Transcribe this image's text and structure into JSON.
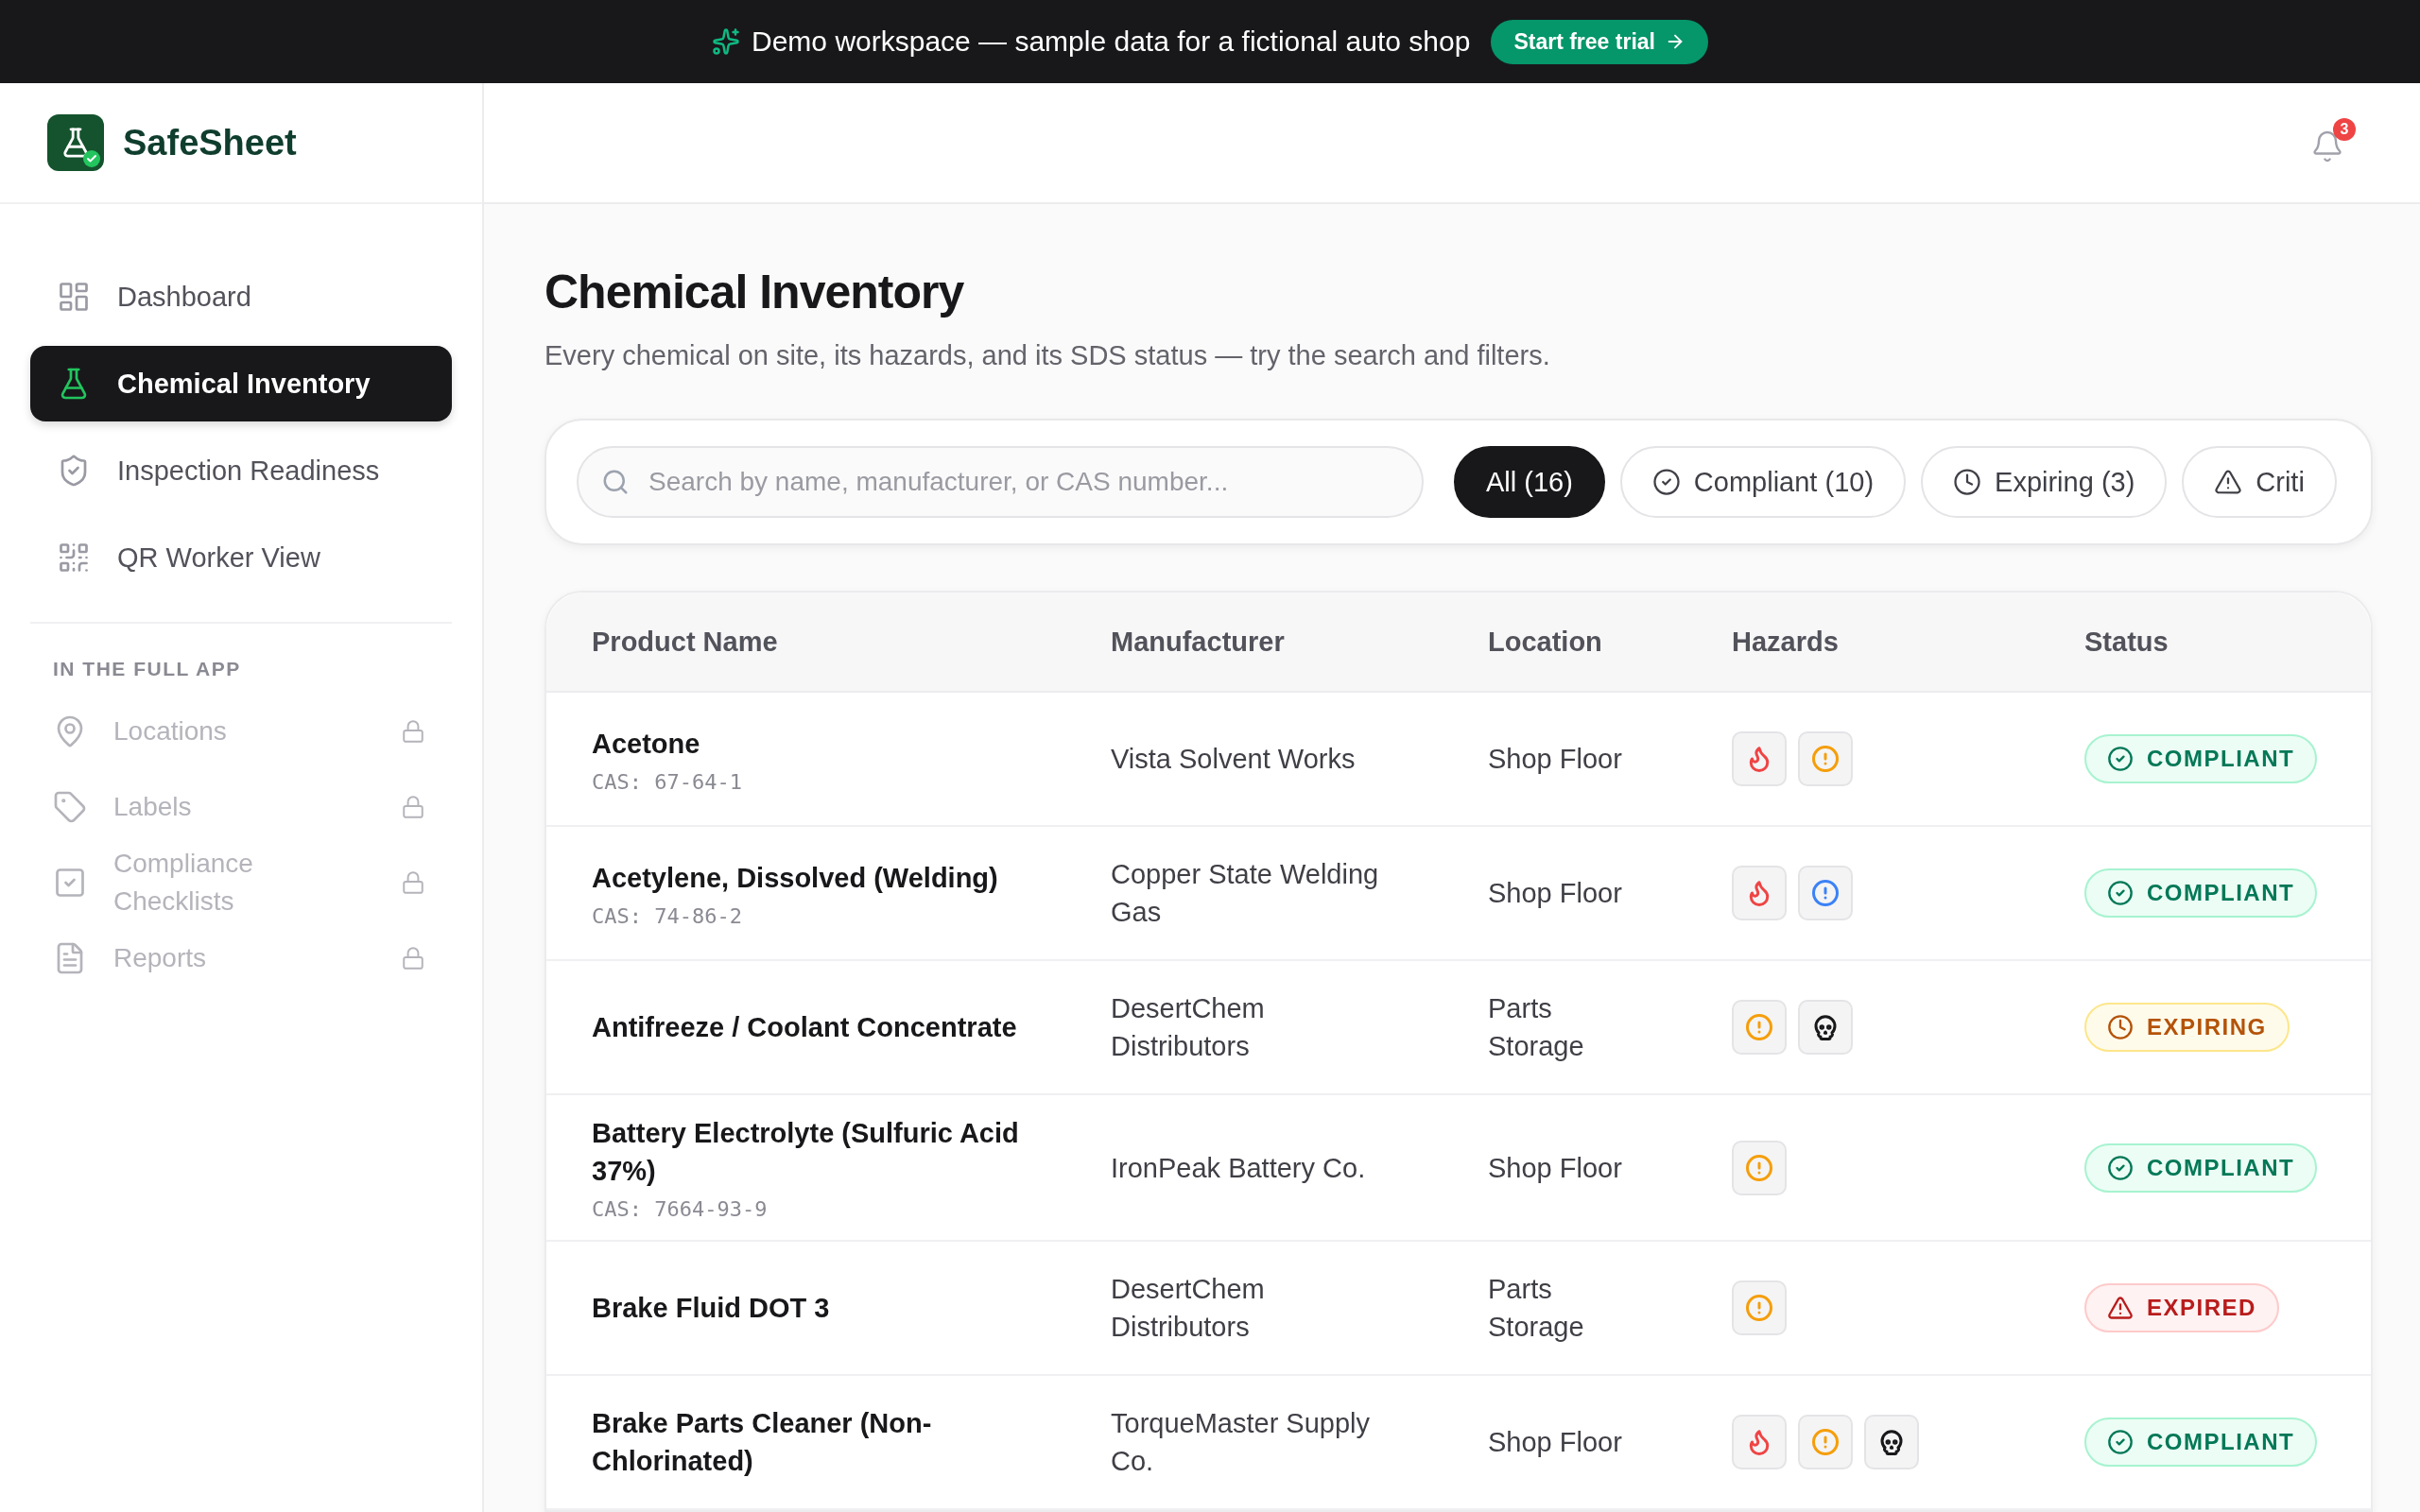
{
  "banner": {
    "text": "Demo workspace — sample data for a fictional auto shop",
    "button": "Start free trial"
  },
  "brand": {
    "name": "SafeSheet"
  },
  "notifications": {
    "count": "3"
  },
  "sidebar": {
    "items": [
      {
        "kind": "dashboard",
        "label": "Dashboard",
        "selected": false
      },
      {
        "kind": "flask",
        "label": "Chemical Inventory",
        "selected": true
      },
      {
        "kind": "shield",
        "label": "Inspection Readiness",
        "selected": false
      },
      {
        "kind": "qr",
        "label": "QR Worker View",
        "selected": false
      }
    ],
    "section_title": "IN THE FULL APP",
    "locked_items": [
      {
        "kind": "pin",
        "label": "Locations"
      },
      {
        "kind": "tag",
        "label": "Labels"
      },
      {
        "kind": "checklist",
        "label": "Compliance Checklists"
      },
      {
        "kind": "report",
        "label": "Reports"
      }
    ]
  },
  "page": {
    "title": "Chemical Inventory",
    "subtitle": "Every chemical on site, its hazards, and its SDS status — try the search and filters."
  },
  "search": {
    "placeholder": "Search by name, manufacturer, or CAS number..."
  },
  "filters": [
    {
      "kind": "all",
      "label": "All (16)",
      "selected": true
    },
    {
      "kind": "compliant",
      "label": "Compliant (10)",
      "selected": false
    },
    {
      "kind": "expiring",
      "label": "Expiring (3)",
      "selected": false
    },
    {
      "kind": "critical",
      "label": "Criti",
      "selected": false
    }
  ],
  "table": {
    "columns": [
      "Product Name",
      "Manufacturer",
      "Location",
      "Hazards",
      "Status"
    ],
    "rows": [
      {
        "name": "Acetone",
        "cas": "CAS: 67-64-1",
        "manufacturer": "Vista Solvent Works",
        "location": "Shop Floor",
        "hazards": [
          {
            "kind": "flame",
            "color": "#ef4444"
          },
          {
            "kind": "exclamation",
            "color": "#f59e0b"
          }
        ],
        "status": {
          "kind": "compliant",
          "label": "COMPLIANT"
        }
      },
      {
        "name": "Acetylene, Dissolved (Welding)",
        "cas": "CAS: 74-86-2",
        "manufacturer": "Copper State Welding Gas",
        "location": "Shop Floor",
        "hazards": [
          {
            "kind": "flame",
            "color": "#ef4444"
          },
          {
            "kind": "exclamation",
            "color": "#3b82f6"
          }
        ],
        "status": {
          "kind": "compliant",
          "label": "COMPLIANT"
        }
      },
      {
        "name": "Antifreeze / Coolant Concentrate",
        "manufacturer": "DesertChem Distributors",
        "location": "Parts Storage",
        "hazards": [
          {
            "kind": "exclamation",
            "color": "#f59e0b"
          },
          {
            "kind": "skull",
            "color": "#18181b"
          }
        ],
        "status": {
          "kind": "expiring",
          "label": "EXPIRING"
        }
      },
      {
        "name": "Battery Electrolyte (Sulfuric Acid 37%)",
        "cas": "CAS: 7664-93-9",
        "manufacturer": "IronPeak Battery Co.",
        "location": "Shop Floor",
        "hazards": [
          {
            "kind": "exclamation",
            "color": "#f59e0b"
          }
        ],
        "status": {
          "kind": "compliant",
          "label": "COMPLIANT"
        }
      },
      {
        "name": "Brake Fluid DOT 3",
        "manufacturer": "DesertChem Distributors",
        "location": "Parts Storage",
        "hazards": [
          {
            "kind": "exclamation",
            "color": "#f59e0b"
          }
        ],
        "status": {
          "kind": "expired",
          "label": "EXPIRED"
        }
      },
      {
        "name": "Brake Parts Cleaner (Non-Chlorinated)",
        "manufacturer": "TorqueMaster Supply Co.",
        "location": "Shop Floor",
        "hazards": [
          {
            "kind": "flame",
            "color": "#ef4444"
          },
          {
            "kind": "exclamation",
            "color": "#f59e0b"
          },
          {
            "kind": "skull",
            "color": "#18181b"
          }
        ],
        "status": {
          "kind": "compliant",
          "label": "COMPLIANT"
        }
      }
    ]
  }
}
